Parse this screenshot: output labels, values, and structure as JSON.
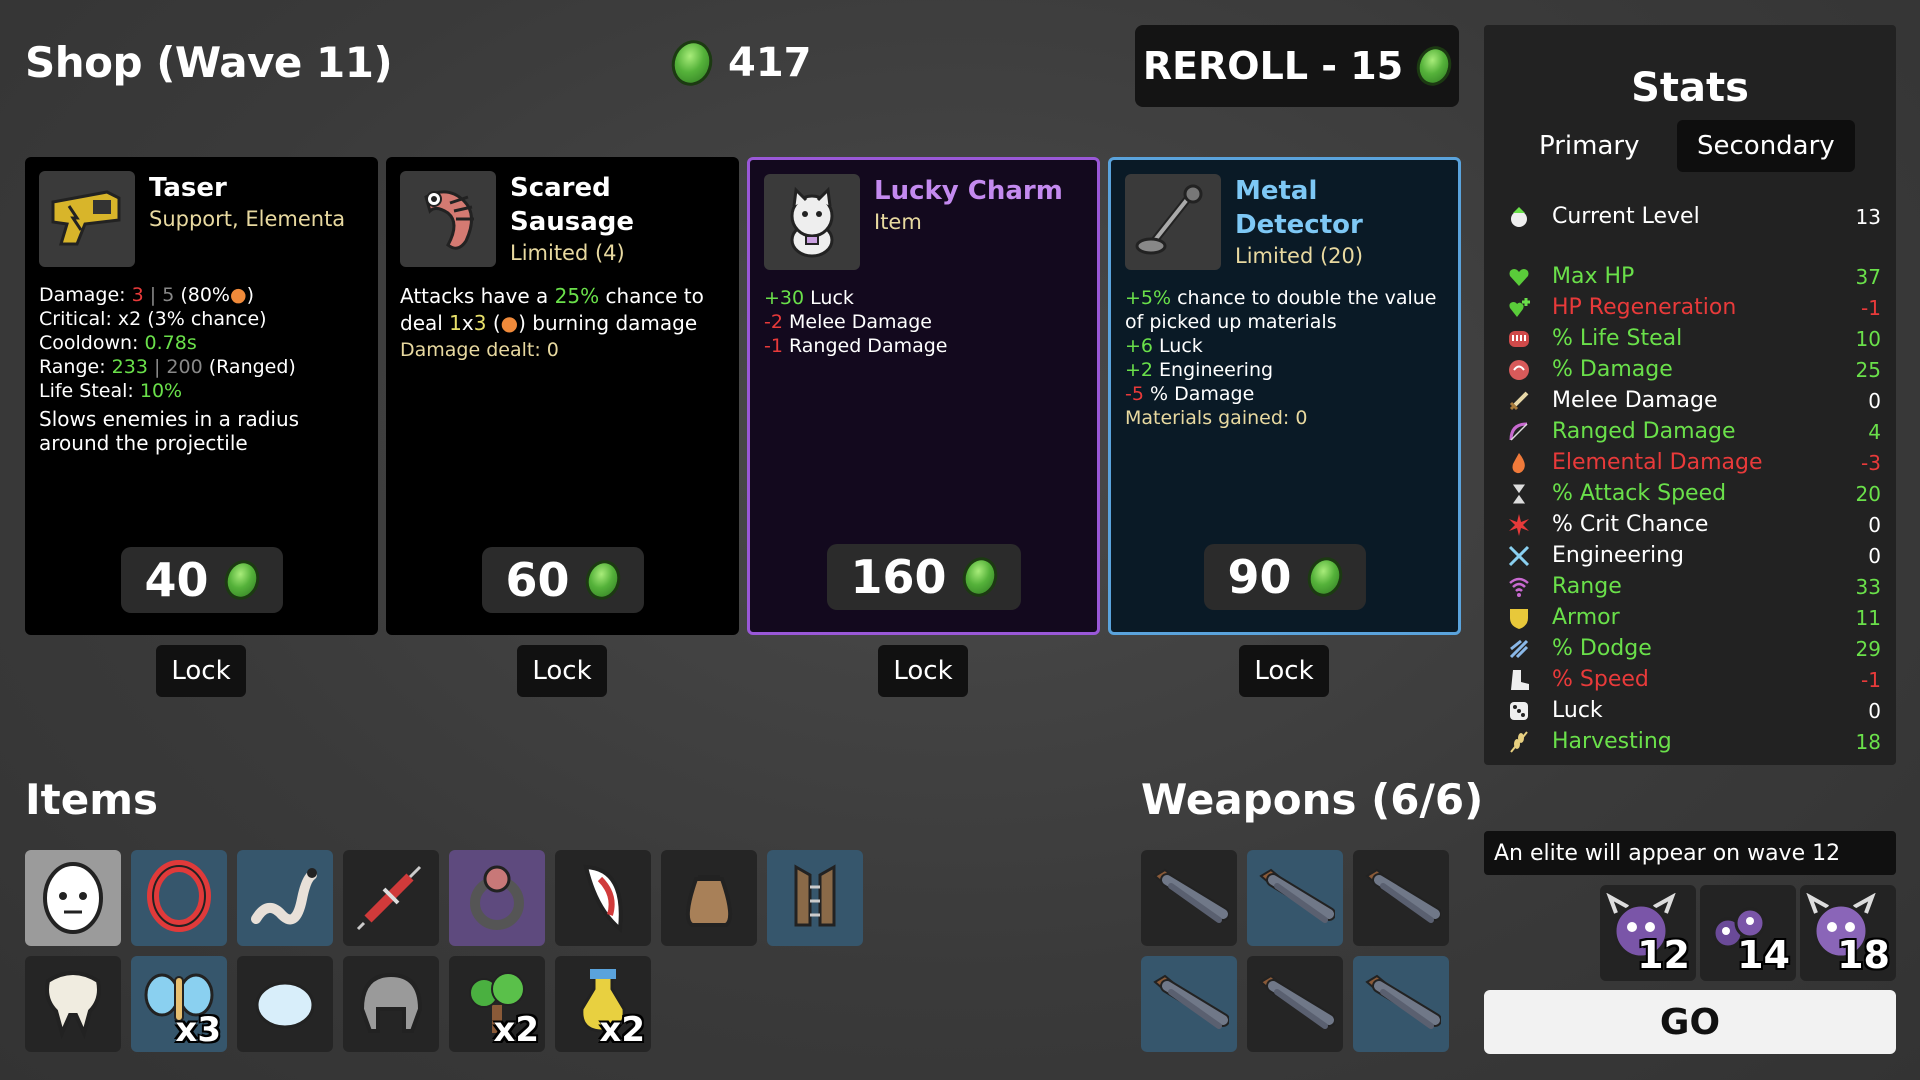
{
  "header": {
    "title": "Shop (Wave 11)",
    "materials": "417",
    "reroll": "REROLL - 15"
  },
  "shop": [
    {
      "name": "Taser",
      "sub": "Support, Elementa",
      "price": "40",
      "lock": "Lock"
    },
    {
      "name": "Scared Sausage",
      "sub": "Limited (4)",
      "price": "60",
      "lock": "Lock"
    },
    {
      "name": "Lucky Charm",
      "sub": "Item",
      "price": "160",
      "lock": "Lock"
    },
    {
      "name": "Metal Detector",
      "sub": "Limited (20)",
      "price": "90",
      "lock": "Lock"
    }
  ],
  "taser": {
    "damage_label": "Damage: ",
    "damage_val": "3",
    "damage_sep": " | ",
    "damage_max": "5",
    "damage_pct": " (80%",
    "damage_end": ")",
    "crit": "Critical: x2 (3% chance)",
    "cooldown_label": "Cooldown: ",
    "cooldown_val": "0.78s",
    "range_label": "Range: ",
    "range_val": "233",
    "range_sep": " | ",
    "range_base": "200",
    "range_end": " (Ranged)",
    "ls_label": "Life Steal: ",
    "ls_val": "10%",
    "desc": "Slows enemies in a radius around the projectile"
  },
  "sausage": {
    "p1": "Attacks have a ",
    "pct": "25%",
    "p2": " chance to deal ",
    "n1": "1",
    "x": "x",
    "n2": "3",
    "p3": " (",
    "p4": ") burning damage",
    "dealt": "Damage dealt: 0"
  },
  "charm": {
    "l1v": "+30",
    "l1": " Luck",
    "l2v": "-2",
    "l2": " Melee Damage",
    "l3v": "-1",
    "l3": " Ranged Damage"
  },
  "detector": {
    "l1v": "+5%",
    "l1": " chance to double the value of picked up materials",
    "l2v": "+6",
    "l2": " Luck",
    "l3v": "+2",
    "l3": " Engineering",
    "l4v": "-5",
    "l4": " % Damage",
    "gained": "Materials gained: 0"
  },
  "stats": {
    "title": "Stats",
    "tab_primary": "Primary",
    "tab_secondary": "Secondary",
    "rows": [
      {
        "label": "Current Level",
        "value": "13",
        "color": "#ffffff",
        "icon": "level-up-icon"
      },
      {
        "label": "Max HP",
        "value": "37",
        "color": "#6ae04a",
        "icon": "heart-icon"
      },
      {
        "label": "HP Regeneration",
        "value": "-1",
        "color": "#e83a3a",
        "icon": "regen-icon"
      },
      {
        "label": "% Life Steal",
        "value": "10",
        "color": "#6ae04a",
        "icon": "teeth-icon"
      },
      {
        "label": "% Damage",
        "value": "25",
        "color": "#6ae04a",
        "icon": "muscle-icon"
      },
      {
        "label": "Melee Damage",
        "value": "0",
        "color": "#ffffff",
        "icon": "sword-icon"
      },
      {
        "label": "Ranged Damage",
        "value": "4",
        "color": "#6ae04a",
        "icon": "bow-icon"
      },
      {
        "label": "Elemental Damage",
        "value": "-3",
        "color": "#e83a3a",
        "icon": "flame-icon"
      },
      {
        "label": "% Attack Speed",
        "value": "20",
        "color": "#6ae04a",
        "icon": "hourglass-icon"
      },
      {
        "label": "% Crit Chance",
        "value": "0",
        "color": "#ffffff",
        "icon": "crit-icon"
      },
      {
        "label": "Engineering",
        "value": "0",
        "color": "#ffffff",
        "icon": "wrench-icon"
      },
      {
        "label": "Range",
        "value": "33",
        "color": "#6ae04a",
        "icon": "range-icon"
      },
      {
        "label": "Armor",
        "value": "11",
        "color": "#6ae04a",
        "icon": "shield-icon"
      },
      {
        "label": "% Dodge",
        "value": "29",
        "color": "#6ae04a",
        "icon": "dodge-icon"
      },
      {
        "label": "% Speed",
        "value": "-1",
        "color": "#e83a3a",
        "icon": "boot-icon"
      },
      {
        "label": "Luck",
        "value": "0",
        "color": "#ffffff",
        "icon": "dice-icon"
      },
      {
        "label": "Harvesting",
        "value": "18",
        "color": "#6ae04a",
        "icon": "wheat-icon"
      }
    ]
  },
  "items_title": "Items",
  "weapons_title": "Weapons (6/6)",
  "items": [
    {
      "icon": "egg-face-icon",
      "qty": ""
    },
    {
      "icon": "red-ring-icon",
      "qty": ""
    },
    {
      "icon": "worm-icon",
      "qty": ""
    },
    {
      "icon": "syringe-icon",
      "qty": ""
    },
    {
      "icon": "dark-ring-icon",
      "qty": ""
    },
    {
      "icon": "fang-icon",
      "qty": ""
    },
    {
      "icon": "sack-icon",
      "qty": ""
    },
    {
      "icon": "vest-icon",
      "qty": ""
    },
    {
      "icon": "tooth-icon",
      "qty": ""
    },
    {
      "icon": "butterfly-icon",
      "qty": "x3"
    },
    {
      "icon": "snowball-icon",
      "qty": ""
    },
    {
      "icon": "helmet-icon",
      "qty": ""
    },
    {
      "icon": "tree-icon",
      "qty": "x2"
    },
    {
      "icon": "potion-icon",
      "qty": "x2"
    }
  ],
  "elite_notice": "An elite will appear on wave 12",
  "waves": [
    "12",
    "14",
    "18"
  ],
  "go": "GO",
  "colors": {
    "green": "#6ae04a",
    "red": "#e83a3a",
    "purple": "#9a58d8",
    "blue": "#5aa3dc"
  }
}
